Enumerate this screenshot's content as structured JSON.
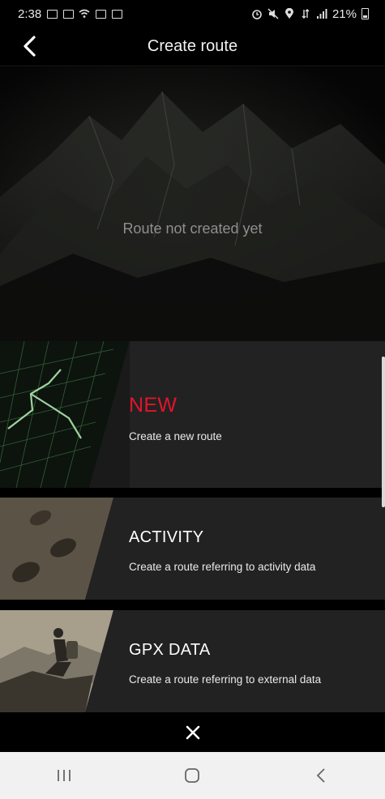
{
  "status_bar": {
    "time": "2:38",
    "battery_percent": "21%",
    "left_icons": [
      "gmail-icon",
      "gmail-icon",
      "wifi-icon",
      "image-icon",
      "calendar-icon"
    ],
    "right_icons": [
      "alarm-icon",
      "mute-icon",
      "location-icon",
      "data-icon",
      "signal-icon",
      "battery-icon"
    ]
  },
  "header": {
    "title": "Create route",
    "back_icon": "chevron-left-icon"
  },
  "map_preview": {
    "empty_message": "Route not created yet"
  },
  "options": [
    {
      "id": "new",
      "title": "NEW",
      "description": "Create a new route",
      "title_color": "#e2142b"
    },
    {
      "id": "activity",
      "title": "ACTIVITY",
      "description": "Create a route referring to activity data",
      "title_color": "#ffffff"
    },
    {
      "id": "gpx",
      "title": "GPX DATA",
      "description": "Create a route referring to external data",
      "title_color": "#ffffff"
    }
  ],
  "close_icon": "close-icon",
  "nav_bar": {
    "icons": [
      "recent-apps-icon",
      "home-icon",
      "back-icon"
    ]
  },
  "colors": {
    "accent": "#e2142b",
    "card_background": "#222222",
    "background": "#000000"
  }
}
